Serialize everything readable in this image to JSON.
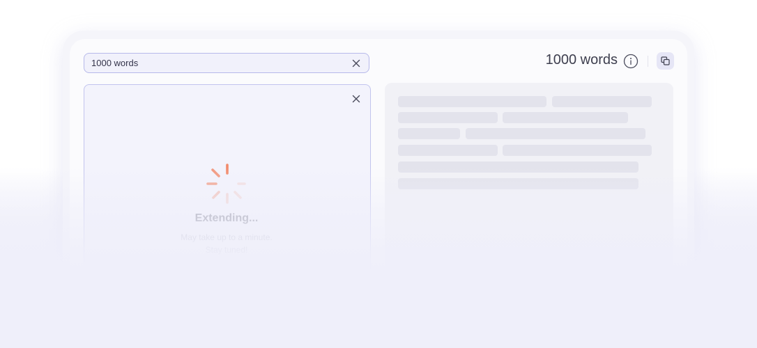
{
  "input": {
    "search_value": "1000 words"
  },
  "status": {
    "title": "Extending...",
    "line1": "May take up to a minute.",
    "line2": "Stay tuned!"
  },
  "output": {
    "word_count": "1000 words"
  },
  "icons": {
    "clear": "close-icon",
    "close_panel": "close-icon",
    "info": "info-icon",
    "copy": "copy-icon",
    "spinner": "loading-spinner-icon"
  },
  "colors": {
    "accent_border": "#b7b9ea",
    "spinner": "#f28a6b",
    "skeleton": "#e3e3ec",
    "copy_bg": "#e6e6f6"
  }
}
